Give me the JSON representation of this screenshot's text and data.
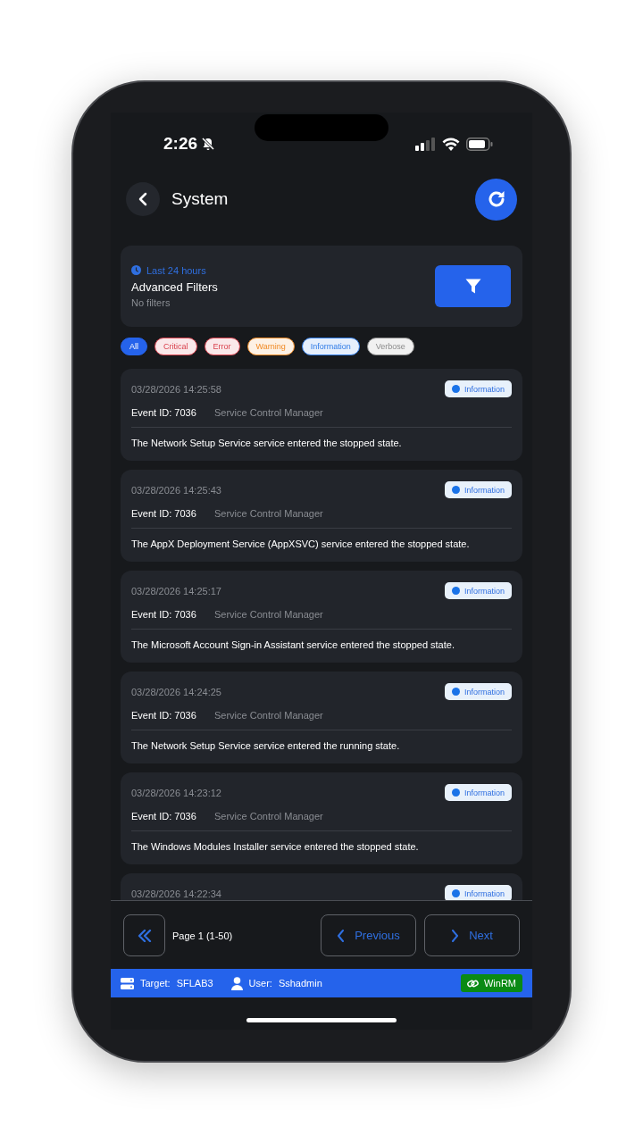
{
  "status_bar": {
    "time": "2:26"
  },
  "header": {
    "title": "System"
  },
  "filter_card": {
    "time_range": "Last 24 hours",
    "title": "Advanced Filters",
    "summary": "No filters"
  },
  "level_chips": [
    {
      "label": "All",
      "selected": true,
      "color": "#2563eb"
    },
    {
      "label": "Critical",
      "selected": false,
      "color": "#d9434f"
    },
    {
      "label": "Error",
      "selected": false,
      "color": "#d9434f"
    },
    {
      "label": "Warning",
      "selected": false,
      "color": "#f08a24"
    },
    {
      "label": "Information",
      "selected": false,
      "color": "#2f7be6"
    },
    {
      "label": "Verbose",
      "selected": false,
      "color": "#8a8a8a"
    }
  ],
  "events": [
    {
      "timestamp": "03/28/2026 14:25:58",
      "level": "Information",
      "event_id": "Event ID: 7036",
      "source": "Service Control Manager",
      "message": "The Network Setup Service service entered the stopped state."
    },
    {
      "timestamp": "03/28/2026 14:25:43",
      "level": "Information",
      "event_id": "Event ID: 7036",
      "source": "Service Control Manager",
      "message": "The AppX Deployment Service (AppXSVC) service entered the stopped state."
    },
    {
      "timestamp": "03/28/2026 14:25:17",
      "level": "Information",
      "event_id": "Event ID: 7036",
      "source": "Service Control Manager",
      "message": "The Microsoft Account Sign-in Assistant service entered the stopped state."
    },
    {
      "timestamp": "03/28/2026 14:24:25",
      "level": "Information",
      "event_id": "Event ID: 7036",
      "source": "Service Control Manager",
      "message": "The Network Setup Service service entered the running state."
    },
    {
      "timestamp": "03/28/2026 14:23:12",
      "level": "Information",
      "event_id": "Event ID: 7036",
      "source": "Service Control Manager",
      "message": "The Windows Modules Installer service entered the stopped state."
    },
    {
      "timestamp": "03/28/2026 14:22:34",
      "level": "Information"
    }
  ],
  "pagination": {
    "page_label": "Page 1 (1-50)",
    "previous": "Previous",
    "next": "Next"
  },
  "connection_bar": {
    "target_label": "Target:",
    "target": "SFLAB3",
    "user_label": "User:",
    "user": "Sshadmin",
    "protocol": "WinRM"
  }
}
